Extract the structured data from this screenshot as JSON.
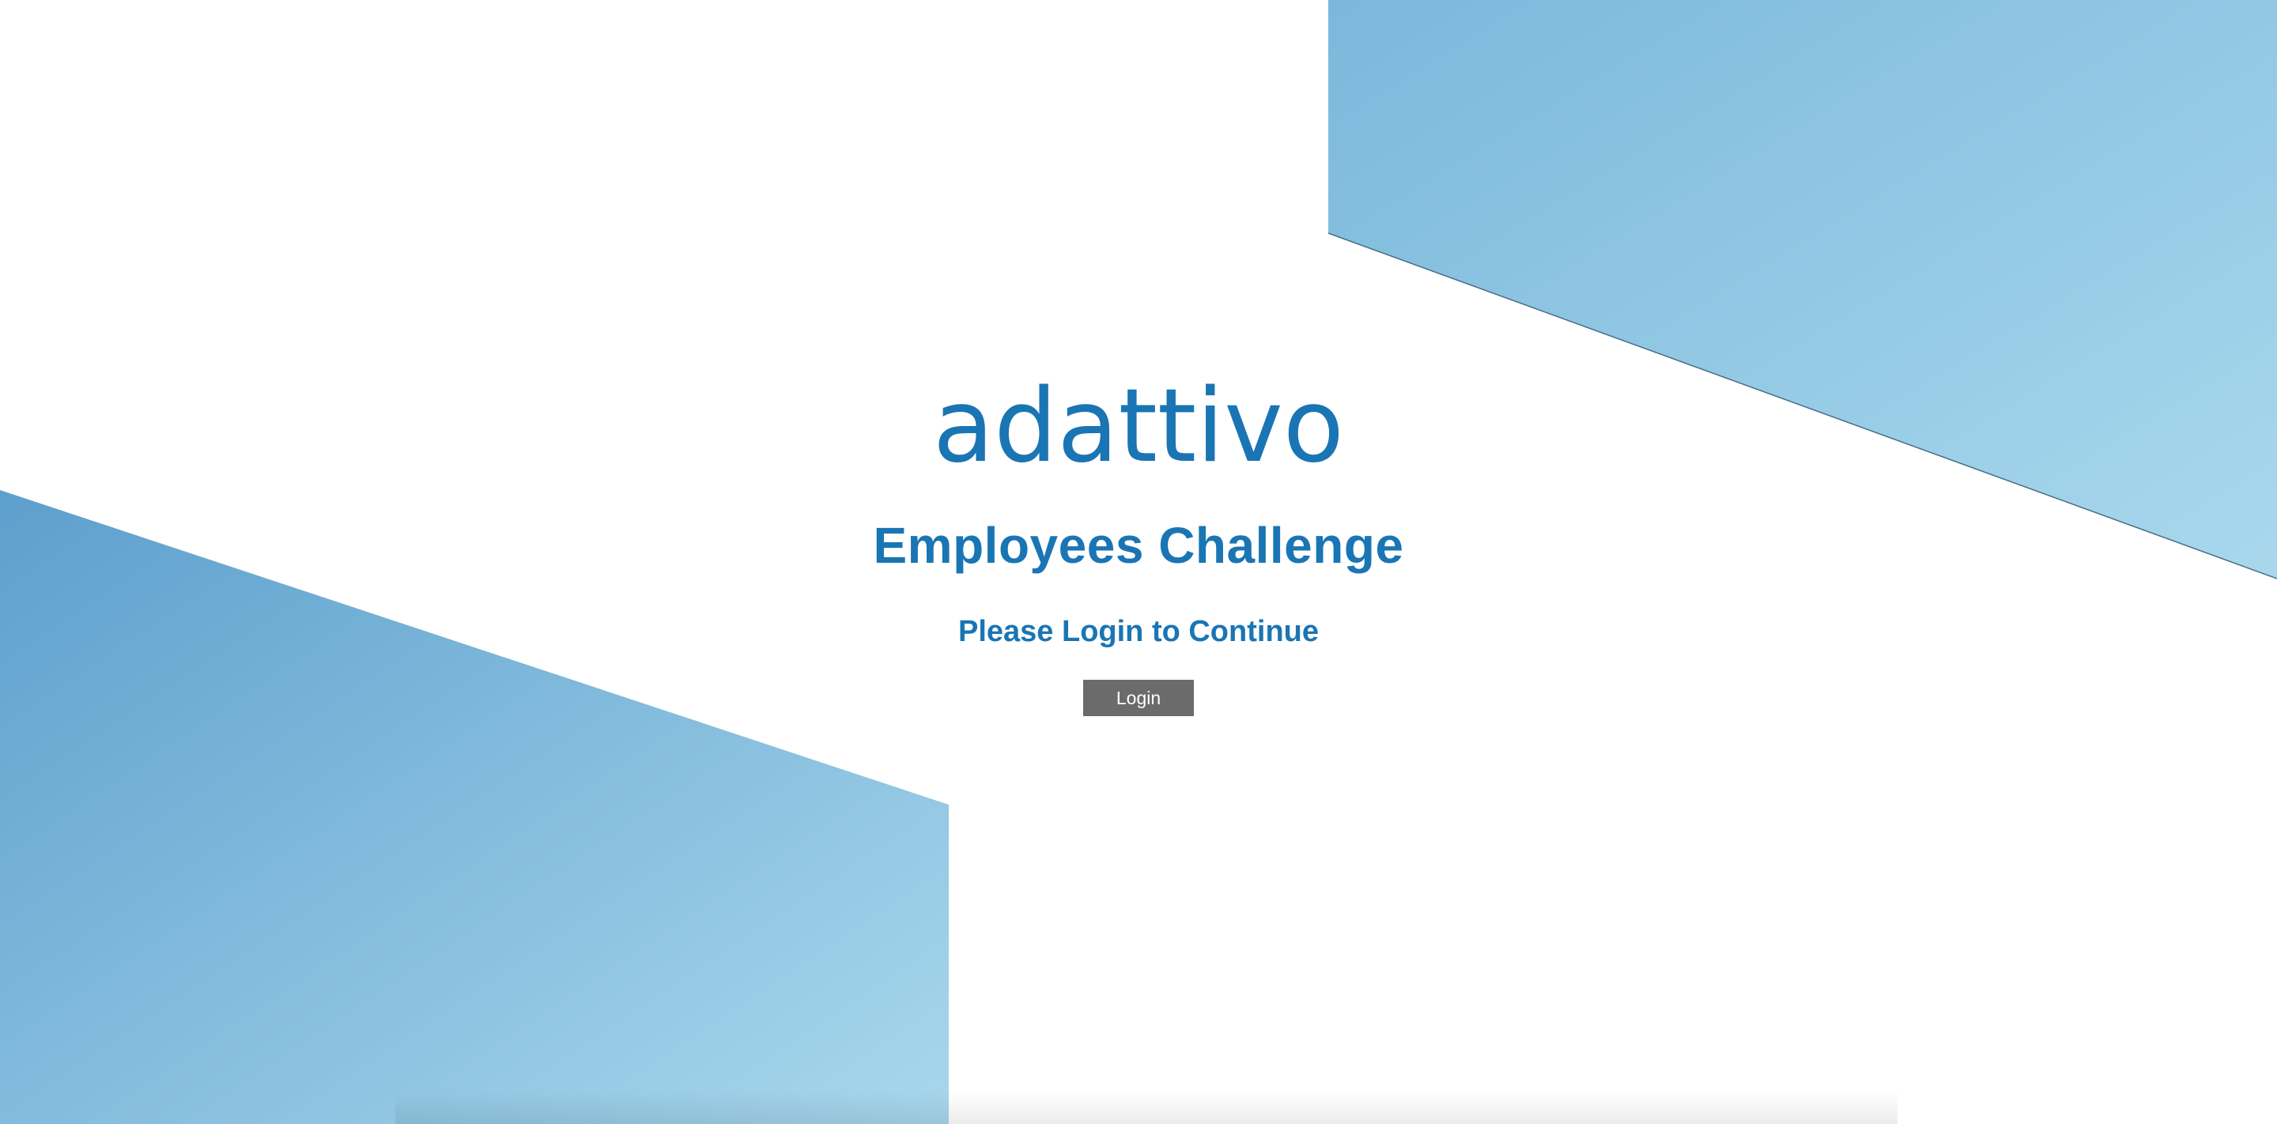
{
  "logo": {
    "text": "adattivo",
    "color": "#1a75b4"
  },
  "heading": {
    "title": "Employees Challenge",
    "subtitle": "Please Login to Continue"
  },
  "actions": {
    "login_label": "Login"
  },
  "colors": {
    "brand_blue": "#1a75b4",
    "button_bg": "#6b6b6b",
    "shape_gradient_start": "#5fa3d0",
    "shape_gradient_end": "#a9d8ed"
  }
}
